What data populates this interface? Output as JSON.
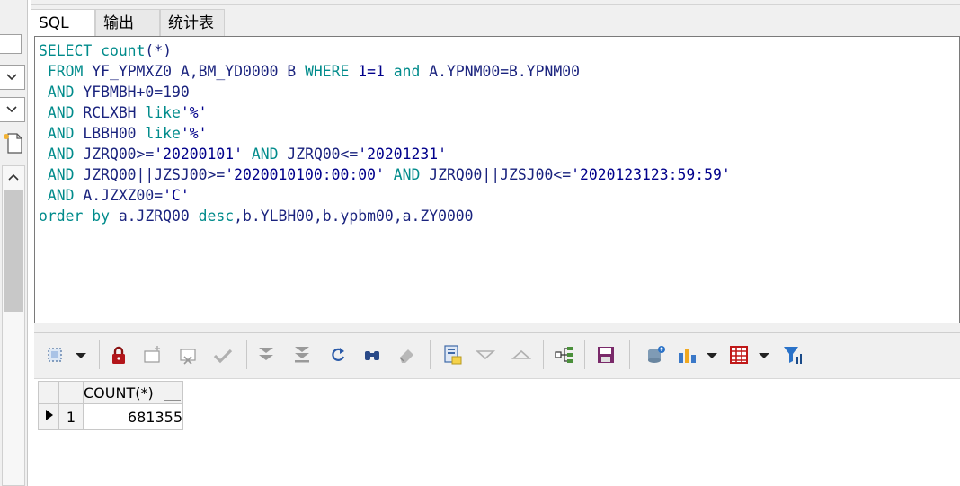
{
  "tabs": [
    {
      "label": "SQL",
      "active": true
    },
    {
      "label": "输出",
      "active": false
    },
    {
      "label": "统计表",
      "active": false
    }
  ],
  "editor": {
    "lines": [
      [
        {
          "t": "SELECT ",
          "c": "kw"
        },
        {
          "t": "count",
          "c": "kw"
        },
        {
          "t": "(*)",
          "c": "op"
        }
      ],
      [
        {
          "t": " FROM ",
          "c": "kw"
        },
        {
          "t": "YF_YPMXZ0 A,BM_YD0000 B ",
          "c": "id"
        },
        {
          "t": "WHERE ",
          "c": "kw"
        },
        {
          "t": "1=1 ",
          "c": "num"
        },
        {
          "t": "and ",
          "c": "kw"
        },
        {
          "t": "A.YPNM00=B.YPNM00",
          "c": "id"
        }
      ],
      [
        {
          "t": " AND ",
          "c": "kw"
        },
        {
          "t": "YFBMBH+0=190",
          "c": "id"
        }
      ],
      [
        {
          "t": " AND ",
          "c": "kw"
        },
        {
          "t": "RCLXBH ",
          "c": "id"
        },
        {
          "t": "like",
          "c": "kw"
        },
        {
          "t": "'%'",
          "c": "str"
        }
      ],
      [
        {
          "t": " AND ",
          "c": "kw"
        },
        {
          "t": "LBBH00 ",
          "c": "id"
        },
        {
          "t": "like",
          "c": "kw"
        },
        {
          "t": "'%'",
          "c": "str"
        }
      ],
      [
        {
          "t": " AND ",
          "c": "kw"
        },
        {
          "t": "JZRQ00>=",
          "c": "id"
        },
        {
          "t": "'20200101' ",
          "c": "str"
        },
        {
          "t": "AND ",
          "c": "kw"
        },
        {
          "t": "JZRQ00<=",
          "c": "id"
        },
        {
          "t": "'20201231'",
          "c": "str"
        }
      ],
      [
        {
          "t": " AND ",
          "c": "kw"
        },
        {
          "t": "JZRQ00||JZSJ00>=",
          "c": "id"
        },
        {
          "t": "'2020010100:00:00' ",
          "c": "str"
        },
        {
          "t": "AND ",
          "c": "kw"
        },
        {
          "t": "JZRQ00||JZSJ00<=",
          "c": "id"
        },
        {
          "t": "'2020123123:59:59'",
          "c": "str"
        }
      ],
      [
        {
          "t": " AND ",
          "c": "kw"
        },
        {
          "t": "A.JZXZ00=",
          "c": "id"
        },
        {
          "t": "'C'",
          "c": "str"
        }
      ],
      [
        {
          "t": "order by ",
          "c": "kw"
        },
        {
          "t": "a.JZRQ00 ",
          "c": "id"
        },
        {
          "t": "desc",
          "c": "kw"
        },
        {
          "t": ",b.YLBH00,b.ypbm00,a.ZY0000",
          "c": "id"
        }
      ]
    ]
  },
  "toolbar": {
    "icons": [
      "select-mode-icon",
      "dropdown-arrow-icon",
      "lock-icon",
      "insert-record-icon",
      "delete-record-icon",
      "post-changes-icon",
      "fetch-next-icon",
      "fetch-last-icon",
      "refresh-icon",
      "query-by-example-icon",
      "clear-icon",
      "export-icon",
      "previous-icon",
      "next-icon",
      "record-view-icon",
      "save-icon",
      "database-icon",
      "chart-icon",
      "chart-dropdown-icon",
      "grid-icon",
      "grid-dropdown-icon",
      "filter-icon"
    ]
  },
  "grid": {
    "columns": [
      "COUNT(*)"
    ],
    "rows": [
      {
        "no": "1",
        "values": [
          "681355"
        ]
      }
    ]
  },
  "colors": {
    "keyword": "#008b8b",
    "identifier": "#1a237e",
    "string": "#00008b",
    "chrome": "#f0f0f0"
  }
}
